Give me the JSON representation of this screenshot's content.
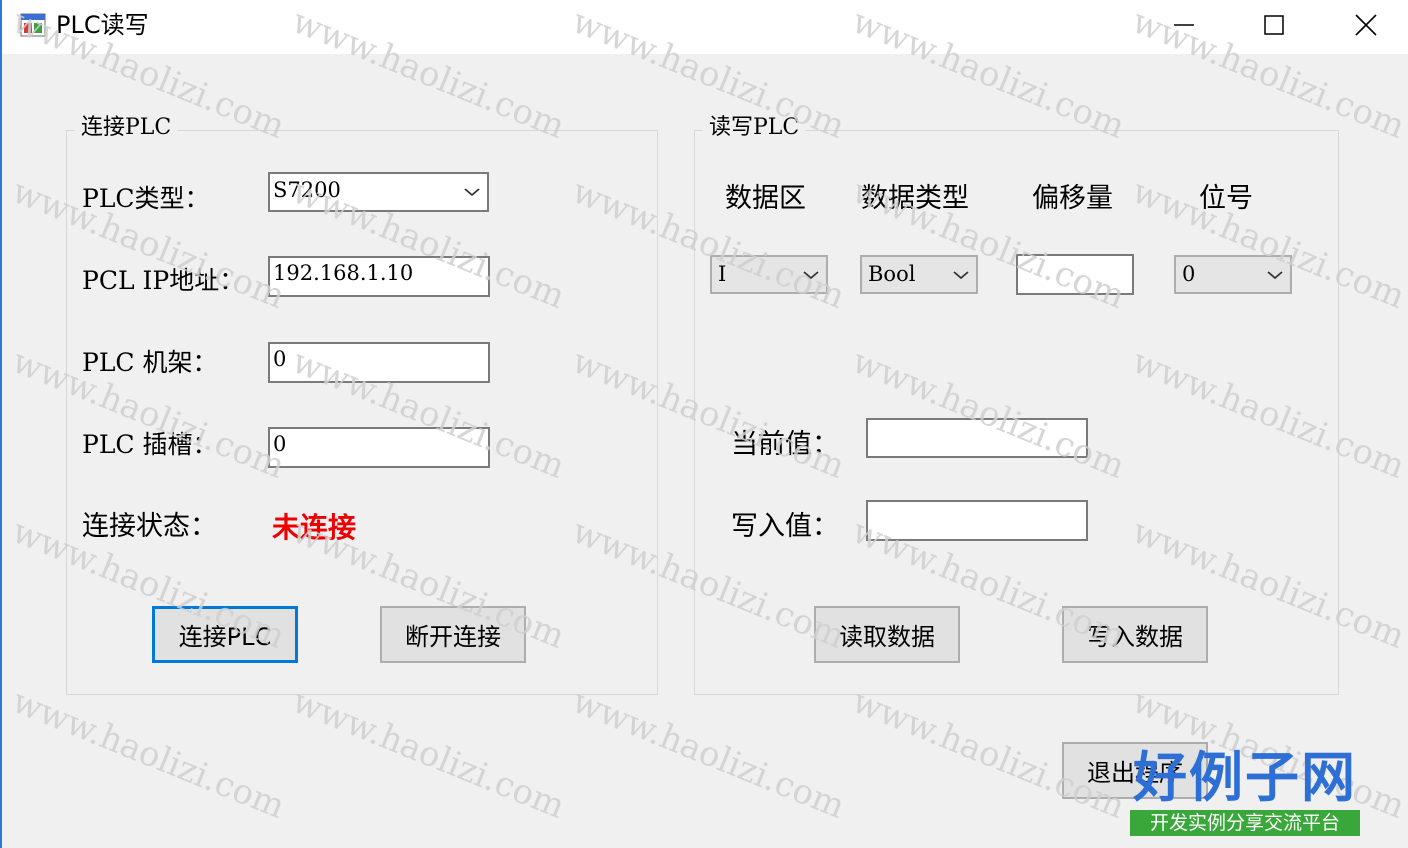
{
  "window": {
    "title": "PLC读写",
    "controls": [
      "minimize",
      "maximize",
      "close"
    ]
  },
  "connect_group": {
    "title": "连接PLC",
    "plc_type_label": "PLC类型：",
    "plc_type_value": "S7200",
    "ip_label": "PCL IP地址：",
    "ip_value": "192.168.1.10",
    "rack_label": "PLC 机架：",
    "rack_value": "0",
    "slot_label": "PLC 插槽：",
    "slot_value": "0",
    "status_label": "连接状态：",
    "status_value": "未连接",
    "status_color": "#ee0000",
    "connect_button": "连接PLC",
    "disconnect_button": "断开连接"
  },
  "rw_group": {
    "title": "读写PLC",
    "col_area": "数据区",
    "col_type": "数据类型",
    "col_offset": "偏移量",
    "col_bit": "位号",
    "area_value": "I",
    "type_value": "Bool",
    "offset_value": "",
    "bit_value": "0",
    "current_label": "当前值：",
    "current_value": "",
    "write_label": "写入值：",
    "write_value": "",
    "read_button": "读取数据",
    "write_button": "写入数据"
  },
  "exit_button": "退出程序",
  "watermark_text": "www.haolizi.com",
  "logo": {
    "main": "好例子网",
    "sub": "开发实例分享交流平台",
    "main_color": "#2e6fd6",
    "sub_bg": "#3aa73a"
  },
  "icons": {
    "app": "app-window-icon",
    "dropdown": "chevron-down-icon"
  }
}
